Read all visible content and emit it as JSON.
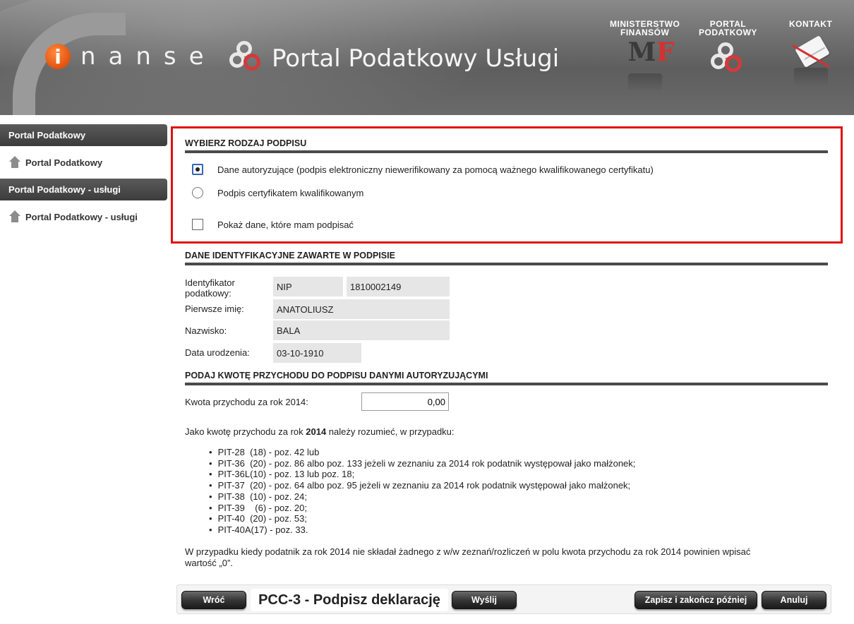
{
  "header": {
    "logo_i": "i",
    "logo_rest": "nanse",
    "portal_title": "Portal Podatkowy Usługi",
    "links": {
      "mf_line1": "MINISTERSTWO",
      "mf_line2": "FINANSÓW",
      "pp_line1": "PORTAL",
      "pp_line2": "PODATKOWY",
      "contact": "KONTAKT"
    }
  },
  "sidebar": {
    "sections": [
      {
        "heading": "Portal Podatkowy",
        "item": "Portal Podatkowy"
      },
      {
        "heading": "Portal Podatkowy - usługi",
        "item": "Portal Podatkowy - usługi"
      }
    ]
  },
  "signature": {
    "title": "WYBIERZ RODZAJ PODPISU",
    "option_auth": "Dane autoryzujące (podpis elektroniczny niewerifikowany za pomocą ważnego kwalifikowanego certyfikatu)",
    "option_cert": "Podpis certyfikatem kwalifikowanym",
    "show_data": "Pokaż dane, które mam podpisać",
    "selected": "auth"
  },
  "identity": {
    "title": "DANE IDENTYFIKACYJNE ZAWARTE W PODPISIE",
    "tax_id_label_1": "Identyfikator",
    "tax_id_label_2": "podatkowy:",
    "tax_id_type": "NIP",
    "tax_id_value": "1810002149",
    "first_name_label": "Pierwsze imię:",
    "first_name": "ANATOLIUSZ",
    "last_name_label": "Nazwisko:",
    "last_name": "BALA",
    "birth_label": "Data urodzenia:",
    "birth_date": "03-10-1910"
  },
  "income": {
    "title": "PODAJ KWOTĘ PRZYCHODU DO PODPISU DANYMI AUTORYZUJĄCYMI",
    "amount_label": "Kwota przychodu za rok 2014:",
    "amount_value": "0,00",
    "intro_before": "Jako kwotę przychodu za rok ",
    "intro_year": "2014",
    "intro_after": " należy rozumieć, w przypadku:",
    "items": [
      "PIT-28  (18) - poz. 42 lub",
      "PIT-36  (20) - poz. 86 albo poz. 133 jeżeli w zeznaniu za 2014 rok podatnik występował jako małżonek;",
      "PIT-36L(10) - poz. 13 lub poz. 18;",
      "PIT-37  (20) - poz. 64 albo poz. 95 jeżeli w zeznaniu za 2014 rok podatnik występował jako małżonek;",
      "PIT-38  (10) - poz. 24;",
      "PIT-39    (6) - poz. 20;",
      "PIT-40  (20) - poz. 53;",
      "PIT-40A(17) - poz. 33."
    ],
    "note_line1": "W przypadku kiedy podatnik za rok 2014 nie składał żadnego z w/w zeznań/rozliczeń w polu kwota przychodu za rok 2014 powinien wpisać",
    "note_line2": "wartość „0”."
  },
  "footer": {
    "back": "Wróć",
    "title": "PCC-3 - Podpisz deklarację",
    "send": "Wyślij",
    "save_later": "Zapisz i zakończ później",
    "cancel": "Anuluj"
  },
  "colors": {
    "highlight_border": "#e01010",
    "accent_orange": "#e2520f"
  }
}
